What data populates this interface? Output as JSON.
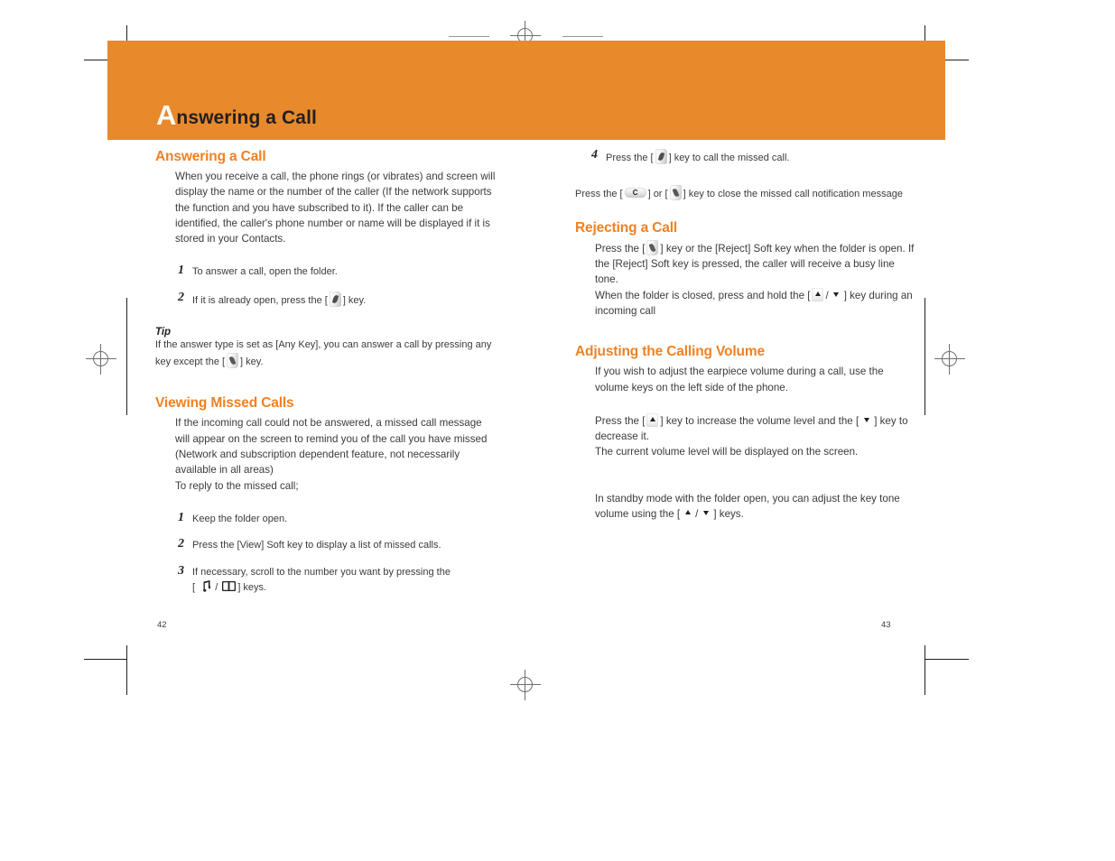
{
  "document": {
    "header": {
      "drop_cap": "A",
      "title_rest": "nswering a Call",
      "band_color": "#e8892b"
    },
    "accent_color": "#f08122",
    "page_numbers": {
      "left": "42",
      "right": "43"
    }
  },
  "left_column": {
    "section1": {
      "heading": "Answering a Call",
      "intro": "When you receive a call, the phone rings (or vibrates) and screen will display the name or the number of the caller (If the network supports the function and you have subscribed to it). If the caller can be identified, the caller's phone number or name will be displayed if it is stored in your Contacts.",
      "steps": [
        {
          "num": "1",
          "text_before": "To answer a call, open the folder.",
          "icon": "",
          "text_after": ""
        },
        {
          "num": "2",
          "text_before": "If it is already open, press the [",
          "icon": "send-key-icon",
          "text_after": "] key."
        }
      ],
      "tip": {
        "label": "Tip",
        "text_before": "If the answer type is set as [Any Key], you can answer a call by pressing any key except the [",
        "icon": "end-key-icon",
        "text_after": "] key."
      }
    },
    "section2": {
      "heading": "Viewing Missed Calls",
      "intro": "If the incoming call could not be answered, a missed call message will appear on the screen to remind you of the call you have missed (Network and subscription dependent feature, not necessarily available in all areas)\nTo reply to the missed call;",
      "steps": [
        {
          "num": "1",
          "text_before": "Keep the folder open.",
          "text_after": ""
        },
        {
          "num": "2",
          "text_before": "Press the [View] Soft key to display a list of missed calls.",
          "text_after": ""
        },
        {
          "num": "3",
          "text_before": "If necessary, scroll to the number you want by pressing the",
          "text_mid": "[",
          "icon_a": "music-note-key-icon",
          "separator": "/",
          "icon_b": "book-key-icon",
          "text_after": "] keys."
        }
      ]
    }
  },
  "right_column": {
    "step4": {
      "num": "4",
      "text_before": "Press the [",
      "icon": "send-key-icon",
      "text_after": "] key to call the missed call."
    },
    "note": {
      "text_before": "Press the [",
      "icon_a": "clear-key-icon",
      "text_mid_1": "] or [",
      "icon_b": "end-key-icon",
      "text_after": "] key to close the missed call notification message"
    },
    "section3": {
      "heading": "Rejecting a Call",
      "line1_before": "Press the [",
      "line1_icon": "end-key-icon",
      "line1_after": "] key or the [Reject] Soft key when the folder is open. If the  [Reject] Soft key is pressed, the caller will receive a busy line tone.",
      "line2_before": "When the folder is closed, press and hold the [",
      "line2_icon_up": "volume-up-key-icon",
      "line2_separator": "/",
      "line2_icon_down": "volume-down-key-icon",
      "line2_after": "] key during an incoming call"
    },
    "section4": {
      "heading": "Adjusting the Calling Volume",
      "intro": "If you wish to adjust the earpiece volume during a call, use the volume keys on the left side of the phone.",
      "para2_before": "Press the [",
      "para2_icon_up": "volume-up-key-icon",
      "para2_mid": "] key to increase the volume level and the [",
      "para2_icon_down": "volume-down-key-icon",
      "para2_after": "] key to decrease it.",
      "para2_line3": "The current volume level will be displayed on the screen.",
      "para3_before": "In standby mode with the folder open, you can adjust the key tone volume using the [",
      "para3_icon_up": "volume-up-key-icon",
      "para3_separator": "/",
      "para3_icon_down": "volume-down-key-icon",
      "para3_after": "] keys."
    }
  }
}
